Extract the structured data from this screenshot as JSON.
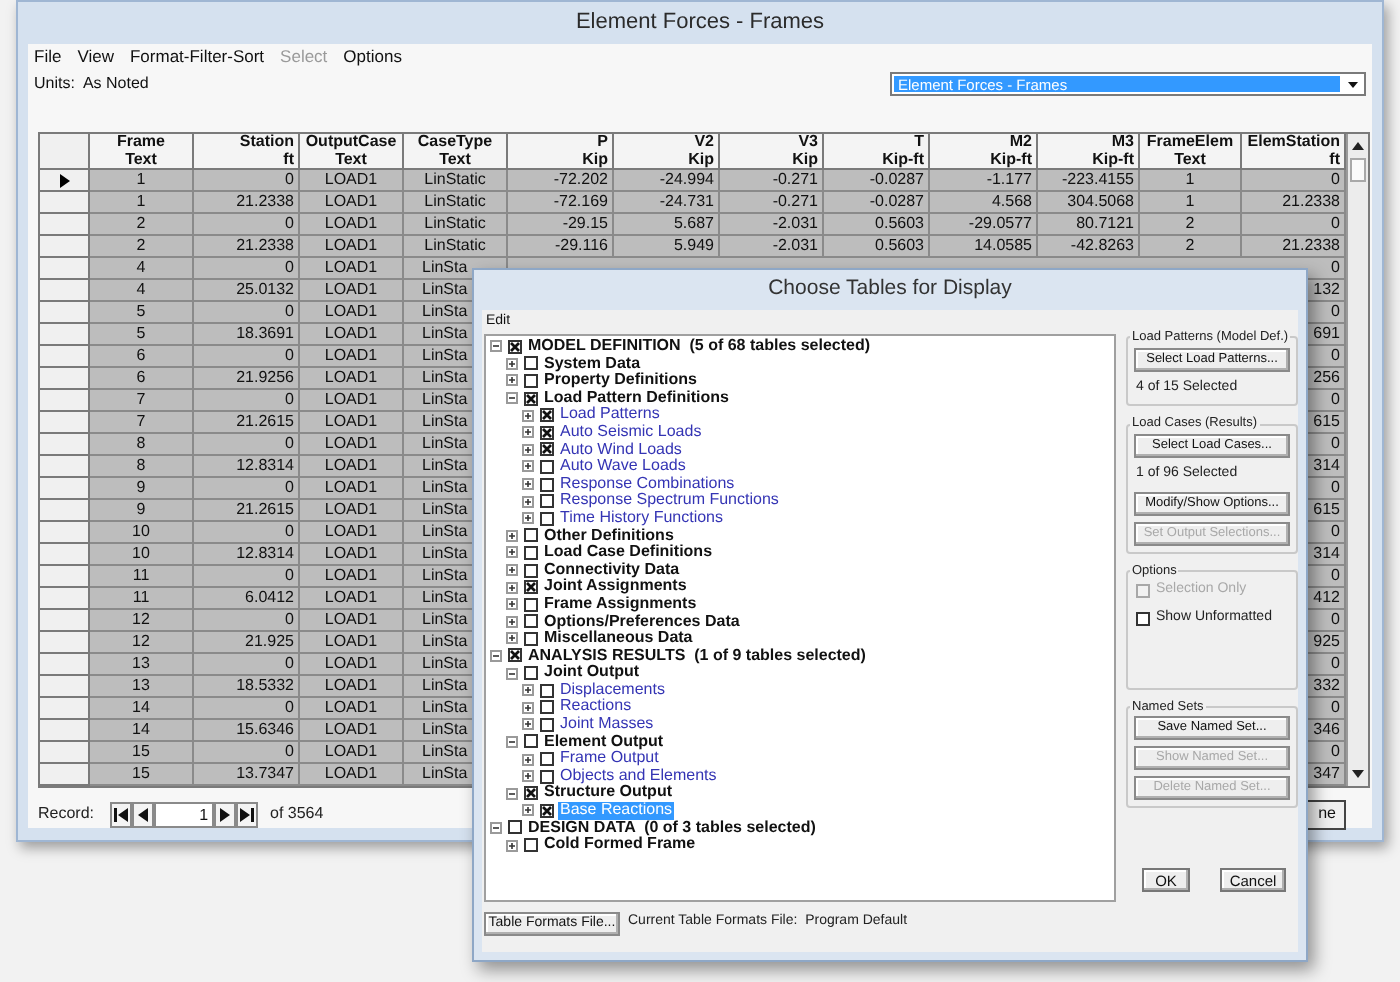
{
  "main_window": {
    "title": "Element Forces - Frames",
    "menu": [
      {
        "label": "File",
        "disabled": false
      },
      {
        "label": "View",
        "disabled": false
      },
      {
        "label": "Format-Filter-Sort",
        "disabled": false
      },
      {
        "label": "Select",
        "disabled": true
      },
      {
        "label": "Options",
        "disabled": false
      }
    ],
    "units": "Units:  As Noted",
    "table_selector": {
      "value": "Element Forces - Frames"
    },
    "table": {
      "columns": [
        {
          "title": "Frame",
          "unit": "Text",
          "kind": "text"
        },
        {
          "title": "Station",
          "unit": "ft",
          "kind": "number"
        },
        {
          "title": "OutputCase",
          "unit": "Text",
          "kind": "text"
        },
        {
          "title": "CaseType",
          "unit": "Text",
          "kind": "text"
        },
        {
          "title": "P",
          "unit": "Kip",
          "kind": "number"
        },
        {
          "title": "V2",
          "unit": "Kip",
          "kind": "number"
        },
        {
          "title": "V3",
          "unit": "Kip",
          "kind": "number"
        },
        {
          "title": "T",
          "unit": "Kip-ft",
          "kind": "number"
        },
        {
          "title": "M2",
          "unit": "Kip-ft",
          "kind": "number"
        },
        {
          "title": "M3",
          "unit": "Kip-ft",
          "kind": "number"
        },
        {
          "title": "FrameElem",
          "unit": "Text",
          "kind": "text"
        },
        {
          "title": "ElemStation",
          "unit": "ft",
          "kind": "number"
        }
      ],
      "rows": [
        {
          "kind": "full",
          "selected": true,
          "cells": [
            "1",
            "0",
            "LOAD1",
            "LinStatic",
            "-72.202",
            "-24.994",
            "-0.271",
            "-0.0287",
            "-1.177",
            "-223.4155",
            "1",
            "0"
          ]
        },
        {
          "kind": "full",
          "selected": false,
          "cells": [
            "1",
            "21.2338",
            "LOAD1",
            "LinStatic",
            "-72.169",
            "-24.731",
            "-0.271",
            "-0.0287",
            "4.568",
            "304.5068",
            "1",
            "21.2338"
          ]
        },
        {
          "kind": "full",
          "selected": false,
          "cells": [
            "2",
            "0",
            "LOAD1",
            "LinStatic",
            "-29.15",
            "5.687",
            "-2.031",
            "0.5603",
            "-29.0577",
            "80.7121",
            "2",
            "0"
          ]
        },
        {
          "kind": "full",
          "selected": false,
          "cells": [
            "2",
            "21.2338",
            "LOAD1",
            "LinStatic",
            "-29.116",
            "5.949",
            "-2.031",
            "0.5603",
            "14.0585",
            "-42.8263",
            "2",
            "21.2338"
          ]
        },
        {
          "kind": "covered",
          "selected": false,
          "cells": [
            "4",
            "0",
            "LOAD1",
            "LinSta"
          ],
          "last_cell": "0"
        },
        {
          "kind": "covered",
          "selected": false,
          "cells": [
            "4",
            "25.0132",
            "LOAD1",
            "LinSta"
          ],
          "last_cell": "132"
        },
        {
          "kind": "covered",
          "selected": false,
          "cells": [
            "5",
            "0",
            "LOAD1",
            "LinSta"
          ],
          "last_cell": "0"
        },
        {
          "kind": "covered",
          "selected": false,
          "cells": [
            "5",
            "18.3691",
            "LOAD1",
            "LinSta"
          ],
          "last_cell": "691"
        },
        {
          "kind": "covered",
          "selected": false,
          "cells": [
            "6",
            "0",
            "LOAD1",
            "LinSta"
          ],
          "last_cell": "0"
        },
        {
          "kind": "covered",
          "selected": false,
          "cells": [
            "6",
            "21.9256",
            "LOAD1",
            "LinSta"
          ],
          "last_cell": "256"
        },
        {
          "kind": "covered",
          "selected": false,
          "cells": [
            "7",
            "0",
            "LOAD1",
            "LinSta"
          ],
          "last_cell": "0"
        },
        {
          "kind": "covered",
          "selected": false,
          "cells": [
            "7",
            "21.2615",
            "LOAD1",
            "LinSta"
          ],
          "last_cell": "615"
        },
        {
          "kind": "covered",
          "selected": false,
          "cells": [
            "8",
            "0",
            "LOAD1",
            "LinSta"
          ],
          "last_cell": "0"
        },
        {
          "kind": "covered",
          "selected": false,
          "cells": [
            "8",
            "12.8314",
            "LOAD1",
            "LinSta"
          ],
          "last_cell": "314"
        },
        {
          "kind": "covered",
          "selected": false,
          "cells": [
            "9",
            "0",
            "LOAD1",
            "LinSta"
          ],
          "last_cell": "0"
        },
        {
          "kind": "covered",
          "selected": false,
          "cells": [
            "9",
            "21.2615",
            "LOAD1",
            "LinSta"
          ],
          "last_cell": "615"
        },
        {
          "kind": "covered",
          "selected": false,
          "cells": [
            "10",
            "0",
            "LOAD1",
            "LinSta"
          ],
          "last_cell": "0"
        },
        {
          "kind": "covered",
          "selected": false,
          "cells": [
            "10",
            "12.8314",
            "LOAD1",
            "LinSta"
          ],
          "last_cell": "314"
        },
        {
          "kind": "covered",
          "selected": false,
          "cells": [
            "11",
            "0",
            "LOAD1",
            "LinSta"
          ],
          "last_cell": "0"
        },
        {
          "kind": "covered",
          "selected": false,
          "cells": [
            "11",
            "6.0412",
            "LOAD1",
            "LinSta"
          ],
          "last_cell": "412"
        },
        {
          "kind": "covered",
          "selected": false,
          "cells": [
            "12",
            "0",
            "LOAD1",
            "LinSta"
          ],
          "last_cell": "0"
        },
        {
          "kind": "covered",
          "selected": false,
          "cells": [
            "12",
            "21.925",
            "LOAD1",
            "LinSta"
          ],
          "last_cell": "925"
        },
        {
          "kind": "covered",
          "selected": false,
          "cells": [
            "13",
            "0",
            "LOAD1",
            "LinSta"
          ],
          "last_cell": "0"
        },
        {
          "kind": "covered",
          "selected": false,
          "cells": [
            "13",
            "18.5332",
            "LOAD1",
            "LinSta"
          ],
          "last_cell": "332"
        },
        {
          "kind": "covered",
          "selected": false,
          "cells": [
            "14",
            "0",
            "LOAD1",
            "LinSta"
          ],
          "last_cell": "0"
        },
        {
          "kind": "covered",
          "selected": false,
          "cells": [
            "14",
            "15.6346",
            "LOAD1",
            "LinSta"
          ],
          "last_cell": "346"
        },
        {
          "kind": "covered",
          "selected": false,
          "cells": [
            "15",
            "0",
            "LOAD1",
            "LinSta"
          ],
          "last_cell": "0"
        },
        {
          "kind": "covered",
          "selected": false,
          "cells": [
            "15",
            "13.7347",
            "LOAD1",
            "LinSta"
          ],
          "last_cell": "347"
        }
      ]
    },
    "record_bar": {
      "label": "Record:",
      "value": "1",
      "total": "of 3564"
    },
    "done_button": "ne"
  },
  "dialog": {
    "title": "Choose Tables for Display",
    "menu": [
      {
        "label": "Edit",
        "disabled": false
      }
    ],
    "tree": [
      {
        "kind": "section",
        "label": "MODEL DEFINITION  (5 of 68 tables selected)",
        "checked": true,
        "expanded": true,
        "selected": false,
        "children": [
          {
            "kind": "group",
            "label": "System Data",
            "checked": false,
            "expanded": false,
            "selected": false
          },
          {
            "kind": "group",
            "label": "Property Definitions",
            "checked": false,
            "expanded": false,
            "selected": false
          },
          {
            "kind": "group",
            "label": "Load Pattern Definitions",
            "checked": true,
            "expanded": true,
            "selected": false,
            "children": [
              {
                "kind": "table",
                "label": "Load Patterns",
                "checked": true,
                "expanded": false,
                "selected": false
              },
              {
                "kind": "table",
                "label": "Auto Seismic Loads",
                "checked": true,
                "expanded": false,
                "selected": false
              },
              {
                "kind": "table",
                "label": "Auto Wind Loads",
                "checked": true,
                "expanded": false,
                "selected": false
              },
              {
                "kind": "table",
                "label": "Auto Wave Loads",
                "checked": false,
                "expanded": false,
                "selected": false
              },
              {
                "kind": "table",
                "label": "Response Combinations",
                "checked": false,
                "expanded": false,
                "selected": false
              },
              {
                "kind": "table",
                "label": "Response Spectrum Functions",
                "checked": false,
                "expanded": false,
                "selected": false
              },
              {
                "kind": "table",
                "label": "Time History Functions",
                "checked": false,
                "expanded": false,
                "selected": false
              }
            ]
          },
          {
            "kind": "group",
            "label": "Other Definitions",
            "checked": false,
            "expanded": false,
            "selected": false
          },
          {
            "kind": "group",
            "label": "Load Case Definitions",
            "checked": false,
            "expanded": false,
            "selected": false
          },
          {
            "kind": "group",
            "label": "Connectivity Data",
            "checked": false,
            "expanded": false,
            "selected": false
          },
          {
            "kind": "group",
            "label": "Joint Assignments",
            "checked": true,
            "expanded": false,
            "selected": false
          },
          {
            "kind": "group",
            "label": "Frame Assignments",
            "checked": false,
            "expanded": false,
            "selected": false
          },
          {
            "kind": "group",
            "label": "Options/Preferences Data",
            "checked": false,
            "expanded": false,
            "selected": false
          },
          {
            "kind": "group",
            "label": "Miscellaneous Data",
            "checked": false,
            "expanded": false,
            "selected": false
          }
        ]
      },
      {
        "kind": "section",
        "label": "ANALYSIS RESULTS  (1 of 9 tables selected)",
        "checked": true,
        "expanded": true,
        "selected": false,
        "children": [
          {
            "kind": "group",
            "label": "Joint Output",
            "checked": false,
            "expanded": true,
            "selected": false,
            "children": [
              {
                "kind": "table",
                "label": "Displacements",
                "checked": false,
                "expanded": false,
                "selected": false
              },
              {
                "kind": "table",
                "label": "Reactions",
                "checked": false,
                "expanded": false,
                "selected": false
              },
              {
                "kind": "table",
                "label": "Joint Masses",
                "checked": false,
                "expanded": false,
                "selected": false
              }
            ]
          },
          {
            "kind": "group",
            "label": "Element Output",
            "checked": false,
            "expanded": true,
            "selected": false,
            "children": [
              {
                "kind": "table",
                "label": "Frame Output",
                "checked": false,
                "expanded": false,
                "selected": false
              },
              {
                "kind": "table",
                "label": "Objects and Elements",
                "checked": false,
                "expanded": false,
                "selected": false
              }
            ]
          },
          {
            "kind": "group",
            "label": "Structure Output",
            "checked": true,
            "expanded": true,
            "selected": false,
            "children": [
              {
                "kind": "table",
                "label": "Base Reactions",
                "checked": true,
                "expanded": false,
                "selected": true
              }
            ]
          }
        ]
      },
      {
        "kind": "section",
        "label": "DESIGN DATA  (0 of 3 tables selected)",
        "checked": false,
        "expanded": true,
        "selected": false,
        "children": [
          {
            "kind": "group",
            "label": "Cold Formed Frame",
            "checked": false,
            "expanded": false,
            "selected": false
          }
        ]
      }
    ],
    "groups": [
      {
        "title": "Load Patterns (Model Def.)",
        "items": [
          {
            "kind": "button",
            "label": "Select Load Patterns...",
            "disabled": false
          },
          {
            "kind": "text",
            "label": "4 of 15 Selected"
          }
        ]
      },
      {
        "title": "Load Cases (Results)",
        "items": [
          {
            "kind": "button",
            "label": "Select Load Cases...",
            "disabled": false
          },
          {
            "kind": "text",
            "label": "1 of 96 Selected"
          },
          {
            "kind": "button",
            "label": "Modify/Show Options...",
            "disabled": false
          },
          {
            "kind": "button",
            "label": "Set Output Selections...",
            "disabled": true
          }
        ]
      },
      {
        "title": "Options",
        "items": [
          {
            "kind": "checkbox",
            "label": "Selection Only",
            "checked": false,
            "disabled": true
          },
          {
            "kind": "checkbox",
            "label": "Show Unformatted",
            "checked": false,
            "disabled": false
          }
        ]
      },
      {
        "title": "Named Sets",
        "items": [
          {
            "kind": "button",
            "label": "Save Named Set...",
            "disabled": false
          },
          {
            "kind": "button",
            "label": "Show Named Set...",
            "disabled": true
          },
          {
            "kind": "button",
            "label": "Delete Named Set...",
            "disabled": true
          }
        ]
      }
    ],
    "table_formats_button": "Table Formats File...",
    "current_file": "Current Table Formats File:  Program Default",
    "buttons": [
      "OK",
      "Cancel"
    ]
  }
}
